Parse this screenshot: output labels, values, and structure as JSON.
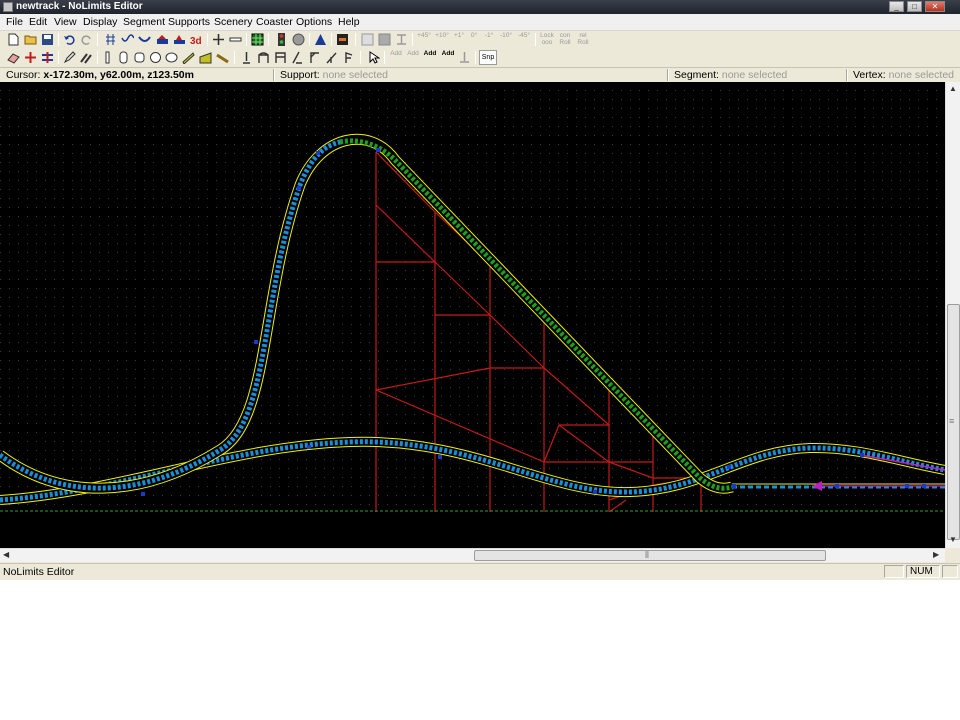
{
  "window": {
    "title": "newtrack - NoLimits Editor",
    "controls": {
      "minimize": "_",
      "maximize": "□",
      "close": "✕"
    }
  },
  "menu": [
    "File",
    "Edit",
    "View",
    "Display",
    "Segment",
    "Supports",
    "Scenery",
    "Coaster",
    "Options",
    "Help"
  ],
  "toolbar_text": {
    "tilt": [
      "+45°",
      "+10°",
      "+1°",
      "0°",
      "-1°",
      "-10°",
      "-45°"
    ],
    "roll": [
      "Lock ooo",
      "con Roll",
      "rel Roll"
    ],
    "add": [
      "Add",
      "Add",
      "Add",
      "Add"
    ],
    "snap": "Snp"
  },
  "info": {
    "cursor_label": "Cursor:",
    "cursor_value": "x-172.30m, y62.00m, z123.50m",
    "support_label": "Support:",
    "support_value": "none selected",
    "segment_label": "Segment:",
    "segment_value": "none selected",
    "vertex_label": "Vertex:",
    "vertex_value": "none selected"
  },
  "status": {
    "text": "NoLimits Editor",
    "num": "NUM"
  },
  "colors": {
    "canvas": "#000000",
    "grid_dot": "#3a3a3a",
    "track_outline": "#f2f200",
    "track_selected": "#1ea01e",
    "track_rails": "#1a8fd8",
    "supports": "#c41a1a",
    "ground": "#35a035",
    "magenta_track": "#c020c0"
  }
}
